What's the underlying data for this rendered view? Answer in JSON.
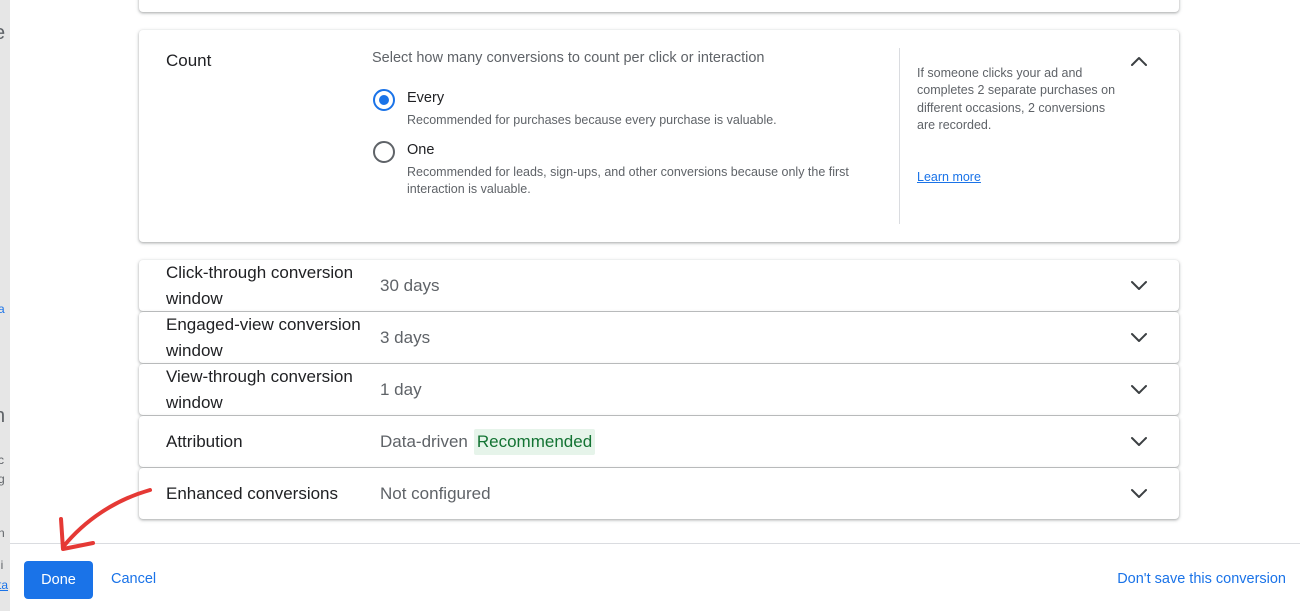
{
  "underlay": {
    "glyph_e": "e",
    "glyph_a": "a",
    "glyph_n": "n",
    "glyph_c": "c",
    "glyph_g": "g",
    "glyph_n2": "n",
    "glyph_li": "li",
    "glyph_ta": "ta"
  },
  "count": {
    "title": "Count",
    "prompt": "Select how many conversions to count per click or interaction",
    "options": [
      {
        "label": "Every",
        "description": "Recommended for purchases because every purchase is valuable.",
        "selected": true
      },
      {
        "label": "One",
        "description": "Recommended for leads, sign-ups, and other conversions because only the first interaction is valuable.",
        "selected": false
      }
    ],
    "help_text": "If someone clicks your ad and completes 2 separate purchases on different occasions, 2 conversions are recorded.",
    "learn_more": "Learn more",
    "collapse_icon": "chevron-up-icon"
  },
  "rows": [
    {
      "title": "Click-through conversion window",
      "value": "30 days"
    },
    {
      "title": "Engaged-view conversion window",
      "value": "3 days"
    },
    {
      "title": "View-through conversion window",
      "value": "1 day"
    },
    {
      "title": "Attribution",
      "value": "Data-driven",
      "badge": "Recommended"
    },
    {
      "title": "Enhanced conversions",
      "value": "Not configured"
    }
  ],
  "footer": {
    "done": "Done",
    "cancel": "Cancel",
    "dont_save": "Don't save this conversion"
  },
  "colors": {
    "accent": "#1a73e8",
    "badge_bg": "#e6f4ea",
    "badge_text": "#137333",
    "arrow": "#e53935"
  }
}
